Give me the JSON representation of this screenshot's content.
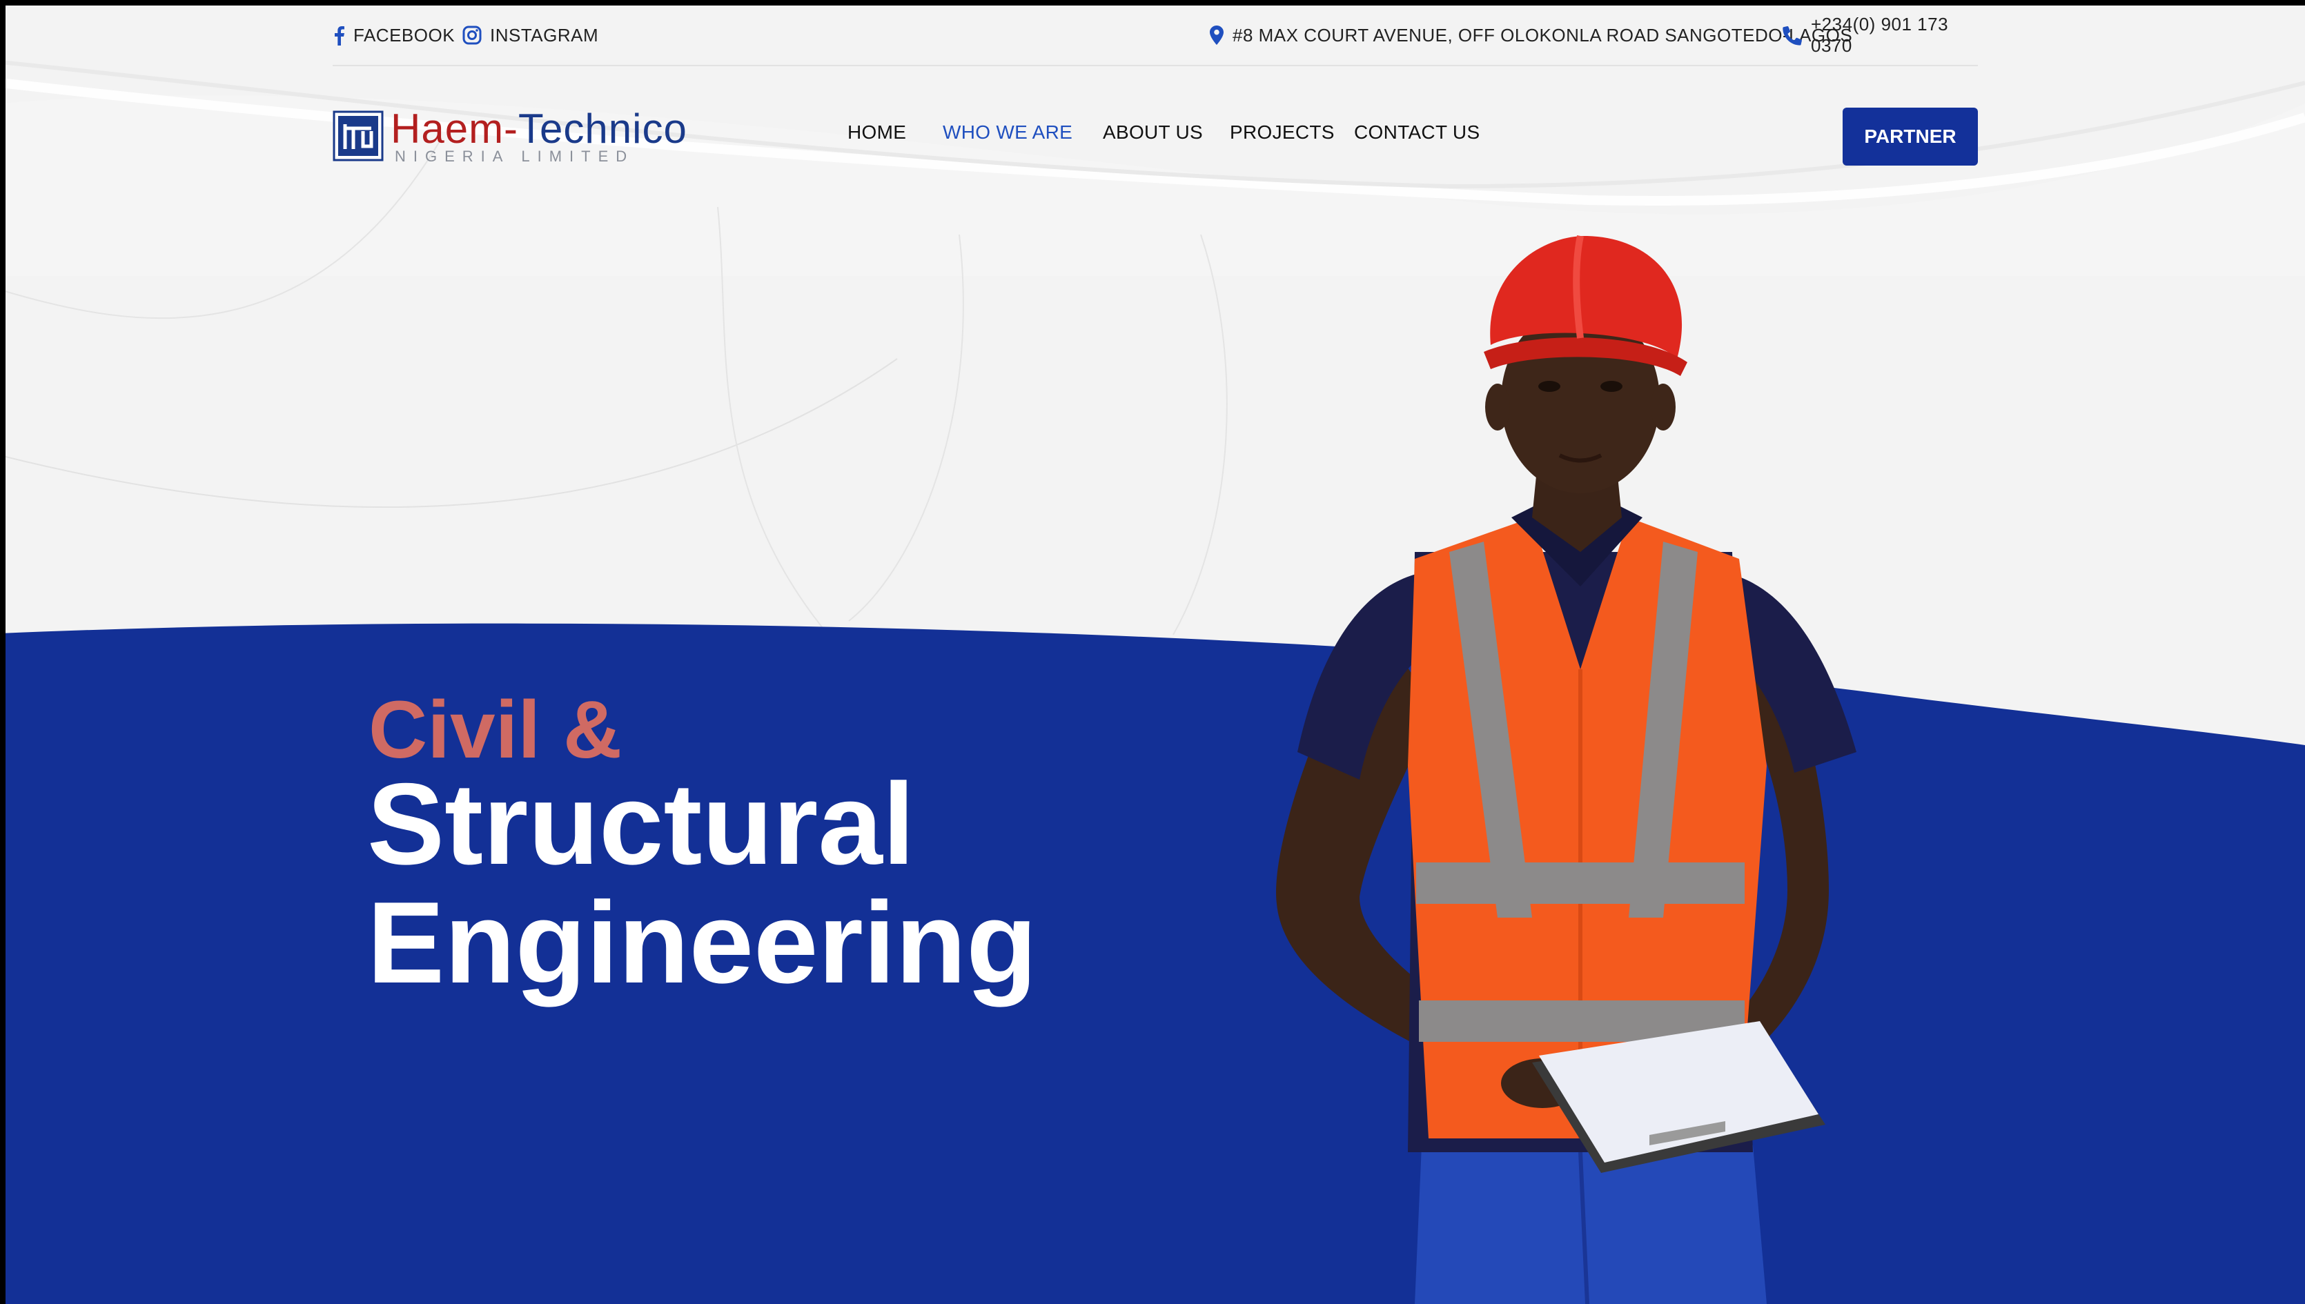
{
  "colors": {
    "brand_blue": "#13319a",
    "hero_blue": "#133096",
    "accent_coral": "#d06a63",
    "nav_active": "#1f4fbf",
    "logo_red": "#b31f1f",
    "page_bg": "#f3f3f3"
  },
  "topbar": {
    "facebook": {
      "icon": "facebook-icon",
      "label": "FACEBOOK"
    },
    "instagram": {
      "icon": "instagram-icon",
      "label": "INSTAGRAM"
    },
    "address": {
      "icon": "map-pin-icon",
      "label": "#8 MAX COURT AVENUE, OFF OLOKONLA ROAD SANGOTEDO-LAGOS"
    },
    "phone": {
      "icon": "phone-icon",
      "label": "+234(0) 901 173 0370"
    }
  },
  "logo": {
    "name_part1": "Haem-",
    "name_part2": "Technico",
    "subtitle": "NIGERIA LIMITED"
  },
  "nav": {
    "items": [
      {
        "label": "HOME",
        "active": false
      },
      {
        "label": "WHO WE ARE",
        "active": true
      },
      {
        "label": "ABOUT US",
        "active": false
      },
      {
        "label": "PROJECTS",
        "active": false
      },
      {
        "label": "CONTACT US",
        "active": false
      }
    ],
    "cta": "PARTNER"
  },
  "hero": {
    "line1": "Civil &",
    "line2": "Structural",
    "line3": "Engineering"
  }
}
